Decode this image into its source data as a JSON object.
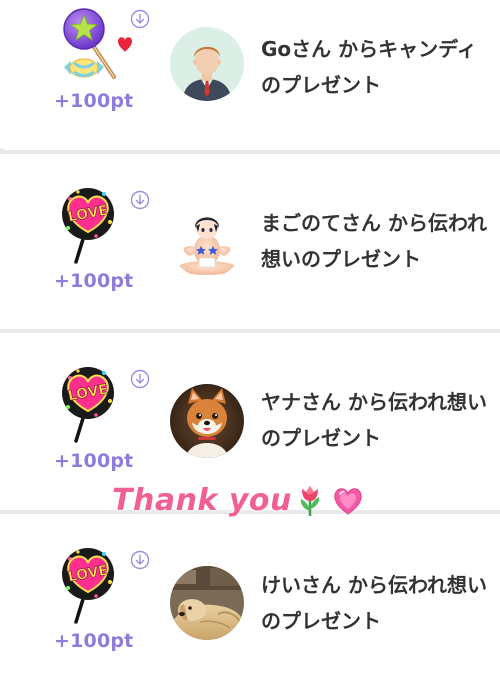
{
  "gifts": [
    {
      "points": "+100pt",
      "message": "Goさん からキャンディのプレゼント",
      "gift_icon": "candy-icon",
      "avatar": "default-male-avatar"
    },
    {
      "points": "+100pt",
      "message": "まごのてさん から伝われ想いのプレゼント",
      "gift_icon": "love-uchiwa-icon",
      "avatar": "anime-figure-avatar"
    },
    {
      "points": "+100pt",
      "message": "ヤナさん から伝われ想いのプレゼント",
      "gift_icon": "love-uchiwa-icon",
      "avatar": "shiba-dog-avatar"
    },
    {
      "points": "+100pt",
      "message": "けいさん から伝われ想いのプレゼント",
      "gift_icon": "love-uchiwa-icon",
      "avatar": "golden-dog-avatar"
    }
  ],
  "overlay": {
    "thank_you_text": "Thank you",
    "decorations": [
      "tulip-emoji",
      "sparkling-heart-emoji"
    ]
  },
  "uchiwa_label": "LOVE",
  "colors": {
    "points": "#8f7bdc",
    "message_text": "#333333",
    "divider": "#e9e9e9",
    "thank_you": "#f25f95",
    "download_icon": "#9d8ee0"
  }
}
